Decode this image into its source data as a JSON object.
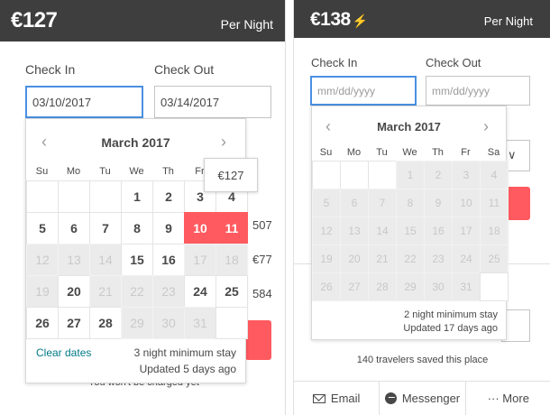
{
  "left": {
    "header": {
      "price": "€127",
      "per_night": "Per Night"
    },
    "check_in_label": "Check In",
    "check_out_label": "Check Out",
    "check_in_value": "03/10/2017",
    "check_out_value": "03/14/2017",
    "calendar": {
      "title": "March 2017",
      "prev_icon": "chevron-left-icon",
      "next_icon": "chevron-right-icon",
      "weekdays": [
        "Su",
        "Mo",
        "Tu",
        "We",
        "Th",
        "Fr",
        "Sa"
      ],
      "clear_dates": "Clear dates",
      "min_stay": "3 night minimum stay",
      "updated": "Updated 5 days ago"
    },
    "tooltip": "€127",
    "behind": {
      "price_a": "507",
      "price_b": "€77",
      "price_c": "584",
      "note": "You won't be charged yet"
    }
  },
  "right": {
    "header": {
      "price": "€138",
      "bolt_icon": "lightning-bolt-icon",
      "per_night": "Per Night"
    },
    "check_in_label": "Check In",
    "check_out_label": "Check Out",
    "check_in_placeholder": "mm/dd/yyyy",
    "check_out_placeholder": "mm/dd/yyyy",
    "calendar": {
      "title": "March 2017",
      "prev_icon": "chevron-left-icon",
      "next_icon": "chevron-right-icon",
      "weekdays": [
        "Su",
        "Mo",
        "Tu",
        "We",
        "Th",
        "Fr",
        "Sa"
      ],
      "min_stay": "2 night minimum stay",
      "updated": "Updated 17 days ago"
    },
    "saved_text": "140 travelers saved this place",
    "footer": {
      "email": "Email",
      "messenger": "Messenger",
      "more": "··· More"
    }
  },
  "colors": {
    "accent": "#ff5a5f",
    "link": "#007a87",
    "focus": "#4a90e2",
    "header": "#3e3e3e"
  }
}
